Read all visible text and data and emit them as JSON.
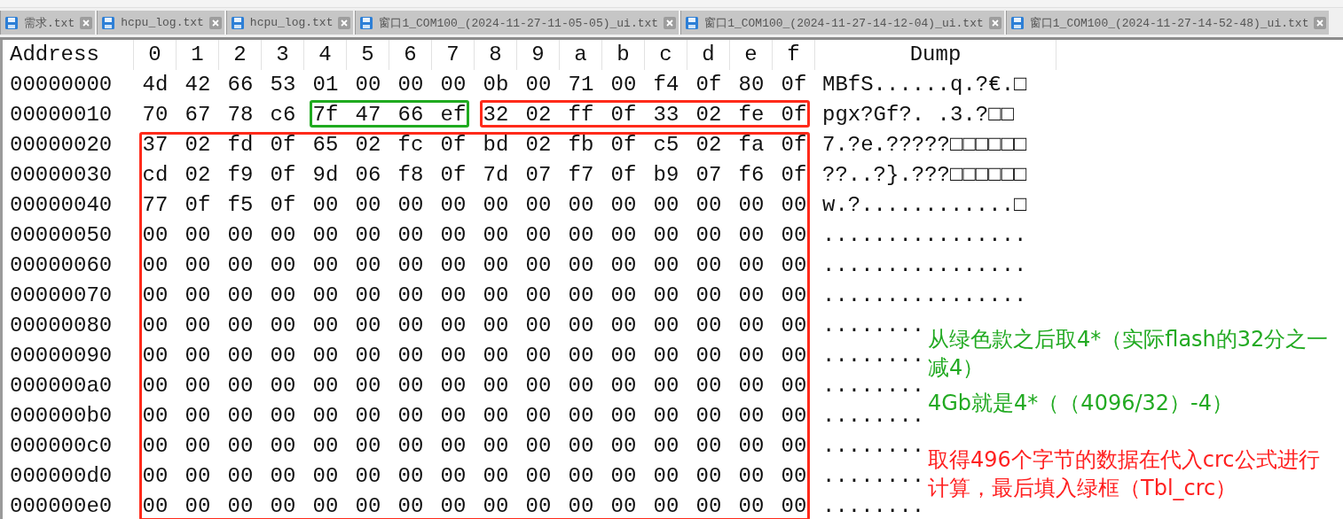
{
  "tabs": [
    {
      "label": "需求.txt",
      "selected": false
    },
    {
      "label": "hcpu_log.txt",
      "selected": false
    },
    {
      "label": "hcpu_log.txt",
      "selected": false
    },
    {
      "label": "窗口1_COM100_(2024-11-27-11-05-05)_ui.txt",
      "selected": false
    },
    {
      "label": "窗口1_COM100_(2024-11-27-14-12-04)_ui.txt",
      "selected": false
    },
    {
      "label": "窗口1_COM100_(2024-11-27-14-52-48)_ui.txt",
      "selected": false
    }
  ],
  "hex_view": {
    "columns": [
      "Address",
      "0",
      "1",
      "2",
      "3",
      "4",
      "5",
      "6",
      "7",
      "8",
      "9",
      "a",
      "b",
      "c",
      "d",
      "e",
      "f",
      "Dump"
    ],
    "rows": [
      {
        "address": "00000000",
        "bytes": [
          "4d",
          "42",
          "66",
          "53",
          "01",
          "00",
          "00",
          "00",
          "0b",
          "00",
          "71",
          "00",
          "f4",
          "0f",
          "80",
          "0f"
        ],
        "dump": "MBfS......q.?€.□"
      },
      {
        "address": "00000010",
        "bytes": [
          "70",
          "67",
          "78",
          "c6",
          "7f",
          "47",
          "66",
          "ef",
          "32",
          "02",
          "ff",
          "0f",
          "33",
          "02",
          "fe",
          "0f"
        ],
        "dump": "pgx?Gf?.  .3.?□□"
      },
      {
        "address": "00000020",
        "bytes": [
          "37",
          "02",
          "fd",
          "0f",
          "65",
          "02",
          "fc",
          "0f",
          "bd",
          "02",
          "fb",
          "0f",
          "c5",
          "02",
          "fa",
          "0f"
        ],
        "dump": "7.?e.?????□□□□□□"
      },
      {
        "address": "00000030",
        "bytes": [
          "cd",
          "02",
          "f9",
          "0f",
          "9d",
          "06",
          "f8",
          "0f",
          "7d",
          "07",
          "f7",
          "0f",
          "b9",
          "07",
          "f6",
          "0f"
        ],
        "dump": "??..?}.???□□□□□□"
      },
      {
        "address": "00000040",
        "bytes": [
          "77",
          "0f",
          "f5",
          "0f",
          "00",
          "00",
          "00",
          "00",
          "00",
          "00",
          "00",
          "00",
          "00",
          "00",
          "00",
          "00"
        ],
        "dump": "w.?............□"
      },
      {
        "address": "00000050",
        "bytes": [
          "00",
          "00",
          "00",
          "00",
          "00",
          "00",
          "00",
          "00",
          "00",
          "00",
          "00",
          "00",
          "00",
          "00",
          "00",
          "00"
        ],
        "dump": "................"
      },
      {
        "address": "00000060",
        "bytes": [
          "00",
          "00",
          "00",
          "00",
          "00",
          "00",
          "00",
          "00",
          "00",
          "00",
          "00",
          "00",
          "00",
          "00",
          "00",
          "00"
        ],
        "dump": "................"
      },
      {
        "address": "00000070",
        "bytes": [
          "00",
          "00",
          "00",
          "00",
          "00",
          "00",
          "00",
          "00",
          "00",
          "00",
          "00",
          "00",
          "00",
          "00",
          "00",
          "00"
        ],
        "dump": "................"
      },
      {
        "address": "00000080",
        "bytes": [
          "00",
          "00",
          "00",
          "00",
          "00",
          "00",
          "00",
          "00",
          "00",
          "00",
          "00",
          "00",
          "00",
          "00",
          "00",
          "00"
        ],
        "dump": "........"
      },
      {
        "address": "00000090",
        "bytes": [
          "00",
          "00",
          "00",
          "00",
          "00",
          "00",
          "00",
          "00",
          "00",
          "00",
          "00",
          "00",
          "00",
          "00",
          "00",
          "00"
        ],
        "dump": "........"
      },
      {
        "address": "000000a0",
        "bytes": [
          "00",
          "00",
          "00",
          "00",
          "00",
          "00",
          "00",
          "00",
          "00",
          "00",
          "00",
          "00",
          "00",
          "00",
          "00",
          "00"
        ],
        "dump": "........"
      },
      {
        "address": "000000b0",
        "bytes": [
          "00",
          "00",
          "00",
          "00",
          "00",
          "00",
          "00",
          "00",
          "00",
          "00",
          "00",
          "00",
          "00",
          "00",
          "00",
          "00"
        ],
        "dump": "........"
      },
      {
        "address": "000000c0",
        "bytes": [
          "00",
          "00",
          "00",
          "00",
          "00",
          "00",
          "00",
          "00",
          "00",
          "00",
          "00",
          "00",
          "00",
          "00",
          "00",
          "00"
        ],
        "dump": "........"
      },
      {
        "address": "000000d0",
        "bytes": [
          "00",
          "00",
          "00",
          "00",
          "00",
          "00",
          "00",
          "00",
          "00",
          "00",
          "00",
          "00",
          "00",
          "00",
          "00",
          "00"
        ],
        "dump": "........"
      },
      {
        "address": "000000e0",
        "bytes": [
          "00",
          "00",
          "00",
          "00",
          "00",
          "00",
          "00",
          "00",
          "00",
          "00",
          "00",
          "00",
          "00",
          "00",
          "00",
          "00"
        ],
        "dump": "........"
      }
    ]
  },
  "frames": [
    {
      "color": "#1faa1f"
    },
    {
      "color": "#ff2a1a"
    },
    {
      "color": "#ff2a1a"
    }
  ],
  "notes": [
    {
      "text": "从绿色款之后取4*（实际flash的32分之一减4）",
      "color": "#22aa22"
    },
    {
      "text": "4Gb就是4*（（4096/32）-4）",
      "color": "#22aa22"
    },
    {
      "text": "取得496个字节的数据在代入crc公式进行计算，最后填入绿框（Tbl_crc）",
      "color": "#ff2020"
    }
  ]
}
